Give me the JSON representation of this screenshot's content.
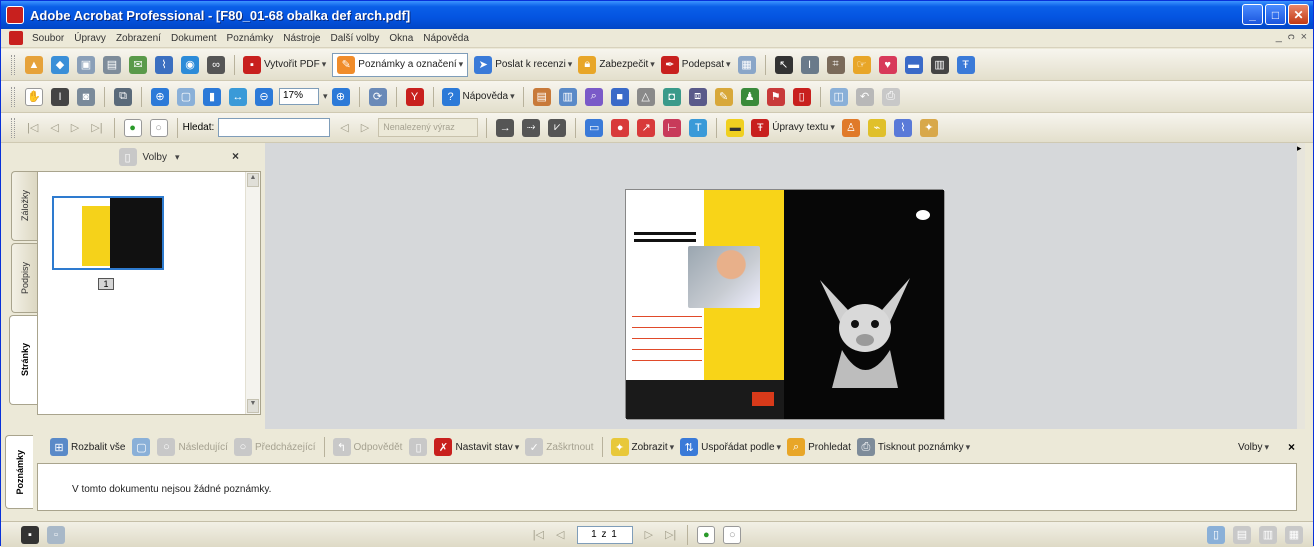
{
  "window": {
    "title": "Adobe Acrobat Professional - [F80_01-68 obalka def arch.pdf]"
  },
  "menu": {
    "items": [
      "Soubor",
      "Úpravy",
      "Zobrazení",
      "Dokument",
      "Poznámky",
      "Nástroje",
      "Další volby",
      "Okna",
      "Nápověda"
    ]
  },
  "toolbar1": {
    "create_pdf": "Vytvořit PDF",
    "comment_markup": "Poznámky a označení",
    "send_review": "Poslat k recenzi",
    "secure": "Zabezpečit",
    "sign": "Podepsat"
  },
  "toolbar2": {
    "zoom_value": "17%",
    "help": "Nápověda"
  },
  "toolbar3": {
    "find_label": "Hledat:",
    "find_value": "",
    "find_prev_next": "Nenalezený výraz",
    "text_edits": "Úpravy textu"
  },
  "nav_panel": {
    "options": "Volby",
    "tabs": [
      "Záložky",
      "Podpisy",
      "Stránky"
    ],
    "active_tab": "Stránky",
    "thumbnail_page": "1"
  },
  "comments_panel": {
    "tab": "Poznámky",
    "expand_all": "Rozbalit vše",
    "next": "Následující",
    "previous": "Předcházející",
    "reply": "Odpovědět",
    "set_status": "Nastavit stav",
    "checkmark": "Zaškrtnout",
    "show": "Zobrazit",
    "sort_by": "Uspořádat podle",
    "search": "Prohledat",
    "print_comments": "Tisknout poznámky",
    "options": "Volby",
    "message": "V tomto dokumentu nejsou žádné poznámky."
  },
  "status": {
    "page_display": "1 z 1"
  },
  "colors": {
    "titlebar": "#0454e0",
    "acrobat_red": "#c8201e",
    "highlight_yellow": "#f8d418"
  }
}
